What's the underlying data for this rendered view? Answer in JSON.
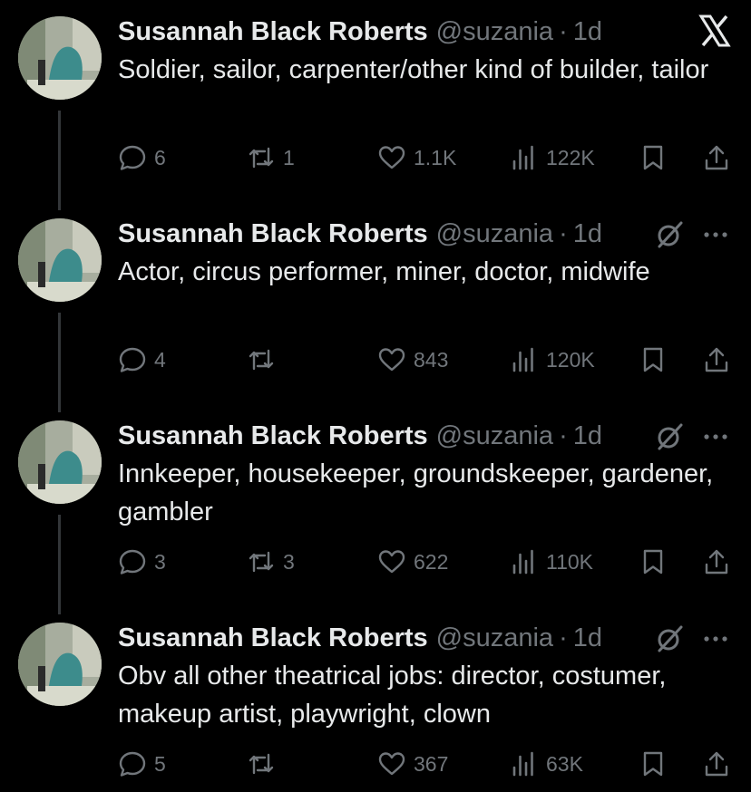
{
  "tweets": [
    {
      "name": "Susannah Black Roberts",
      "handle": "@suzania",
      "time": "1d",
      "text": "Soldier, sailor, carpenter/other kind of builder, tailor",
      "replies": "6",
      "reposts": "1",
      "likes": "1.1K",
      "views": "122K",
      "header_icon": "x-logo-icon"
    },
    {
      "name": "Susannah Black Roberts",
      "handle": "@suzania",
      "time": "1d",
      "text": "Actor, circus performer, miner, doctor, midwife",
      "replies": "4",
      "reposts": "",
      "likes": "843",
      "views": "120K",
      "header_icon": "grok-icon"
    },
    {
      "name": "Susannah Black Roberts",
      "handle": "@suzania",
      "time": "1d",
      "text": "Innkeeper, housekeeper, groundskeeper, gardener, gambler",
      "replies": "3",
      "reposts": "3",
      "likes": "622",
      "views": "110K",
      "header_icon": "grok-icon"
    },
    {
      "name": "Susannah Black Roberts",
      "handle": "@suzania",
      "time": "1d",
      "text": "Obv all other theatrical jobs: director, costumer, makeup artist, playwright, clown",
      "replies": "5",
      "reposts": "",
      "likes": "367",
      "views": "63K",
      "header_icon": "grok-icon"
    }
  ],
  "separator": "·",
  "colors": {
    "background": "#000000",
    "text": "#e7e9ea",
    "muted": "#71767b",
    "thread_line": "#333639"
  }
}
